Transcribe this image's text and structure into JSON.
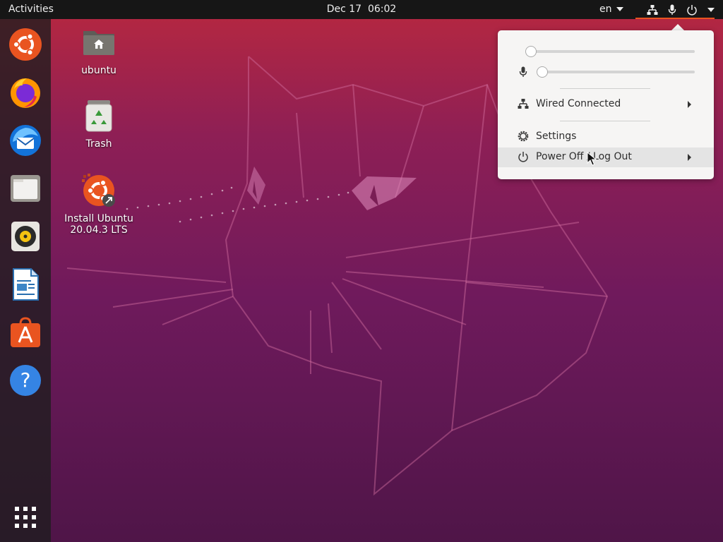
{
  "topbar": {
    "activities": "Activities",
    "date": "Dec 17",
    "time": "06:02",
    "input_lang": "en",
    "tray_icons": [
      "network-wired-icon",
      "microphone-icon",
      "power-icon"
    ]
  },
  "dock": {
    "apps": [
      {
        "name": "ubuntu-icon"
      },
      {
        "name": "firefox-icon"
      },
      {
        "name": "thunderbird-icon"
      },
      {
        "name": "files-icon"
      },
      {
        "name": "rhythmbox-icon"
      },
      {
        "name": "libreoffice-writer-icon"
      },
      {
        "name": "ubuntu-software-icon"
      },
      {
        "name": "help-icon"
      }
    ],
    "show_apps": "show-applications-icon"
  },
  "desktop": {
    "icons": [
      {
        "label": "ubuntu",
        "icon": "home-folder-icon"
      },
      {
        "label": "Trash",
        "icon": "trash-icon"
      },
      {
        "label_line1": "Install Ubuntu",
        "label_line2": "20.04.3 LTS",
        "icon": "ubuntu-installer-icon"
      }
    ]
  },
  "system_menu": {
    "volume_level": 0,
    "mic_level": 0,
    "wired": "Wired Connected",
    "settings": "Settings",
    "power": "Power Off / Log Out"
  },
  "colors": {
    "accent": "#e95420",
    "topbar": "#161616",
    "menu_bg": "#f6f5f4"
  }
}
